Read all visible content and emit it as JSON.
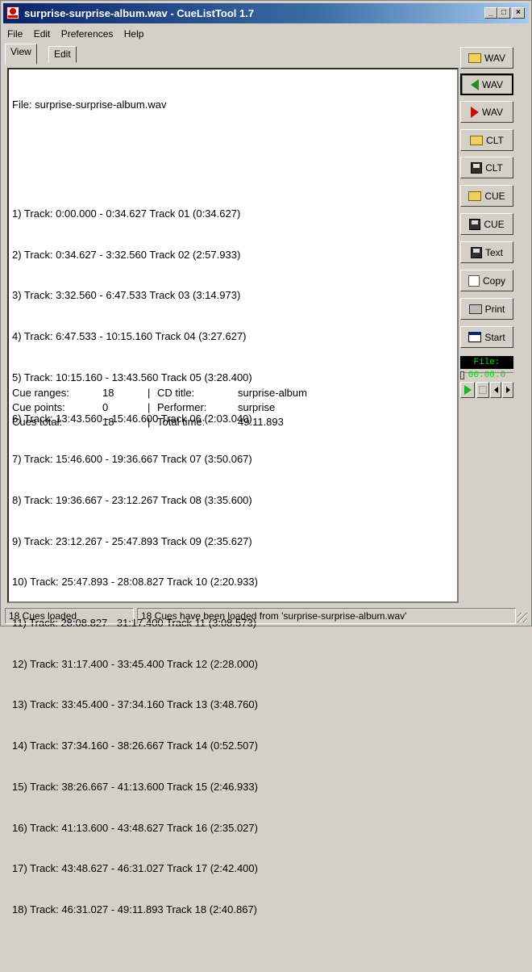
{
  "window": {
    "title": "surprise-surprise-album.wav - CueListTool 1.7"
  },
  "menu": [
    "File",
    "Edit",
    "Preferences",
    "Help"
  ],
  "tabs": [
    "View",
    "Edit"
  ],
  "content": {
    "file_line": "File: surprise-surprise-album.wav",
    "tracks": [
      "1) Track: 0:00.000 - 0:34.627 Track 01 (0:34.627)",
      "2) Track: 0:34.627 - 3:32.560 Track 02 (2:57.933)",
      "3) Track: 3:32.560 - 6:47.533 Track 03 (3:14.973)",
      "4) Track: 6:47.533 - 10:15.160 Track 04 (3:27.627)",
      "5) Track: 10:15.160 - 13:43.560 Track 05 (3:28.400)",
      "6) Track: 13:43.560 - 15:46.600 Track 06 (2:03.040)",
      "7) Track: 15:46.600 - 19:36.667 Track 07 (3:50.067)",
      "8) Track: 19:36.667 - 23:12.267 Track 08 (3:35.600)",
      "9) Track: 23:12.267 - 25:47.893 Track 09 (2:35.627)",
      "10) Track: 25:47.893 - 28:08.827 Track 10 (2:20.933)",
      "11) Track: 28:08.827 - 31:17.400 Track 11 (3:08.573)",
      "12) Track: 31:17.400 - 33:45.400 Track 12 (2:28.000)",
      "13) Track: 33:45.400 - 37:34.160 Track 13 (3:48.760)",
      "14) Track: 37:34.160 - 38:26.667 Track 14 (0:52.507)",
      "15) Track: 38:26.667 - 41:13.600 Track 15 (2:46.933)",
      "16) Track: 41:13.600 - 43:48.627 Track 16 (2:35.027)",
      "17) Track: 43:48.627 - 46:31.027 Track 17 (2:42.400)",
      "18) Track: 46:31.027 - 49:11.893 Track 18 (2:40.867)"
    ],
    "stats": [
      {
        "label": "Cue ranges:",
        "value": "18",
        "sep": "|",
        "label2": "CD title:",
        "value2": "surprise-album"
      },
      {
        "label": "Cue points:",
        "value": "0",
        "sep": "|",
        "label2": "Performer:",
        "value2": "surprise"
      },
      {
        "label": "Cues total:",
        "value": "18",
        "sep": "|",
        "label2": "Total time:",
        "value2": "49:11.893"
      }
    ]
  },
  "sidebar": {
    "buttons": [
      {
        "label": "WAV",
        "icon": "folder-open-icon"
      },
      {
        "label": "WAV",
        "icon": "arrow-left-icon"
      },
      {
        "label": "WAV",
        "icon": "arrow-right-icon"
      },
      {
        "label": "CLT",
        "icon": "folder-open-icon"
      },
      {
        "label": "CLT",
        "icon": "floppy-disk-icon"
      },
      {
        "label": "CUE",
        "icon": "folder-open-icon"
      },
      {
        "label": "CUE",
        "icon": "floppy-disk-icon"
      },
      {
        "label": "Text",
        "icon": "floppy-disk-icon"
      },
      {
        "label": "Copy",
        "icon": "copy-icon"
      },
      {
        "label": "Print",
        "icon": "printer-icon"
      },
      {
        "label": "Start",
        "icon": "window-icon"
      }
    ],
    "time_display": "File: 00:00.0"
  },
  "status": {
    "left": "18 Cues loaded",
    "right": "18 Cues have been loaded from 'surprise-surprise-album.wav'"
  },
  "colors": {
    "titlebar_start": "#0a246a",
    "lcd_text": "#00e000",
    "face": "#d4d0c8"
  }
}
